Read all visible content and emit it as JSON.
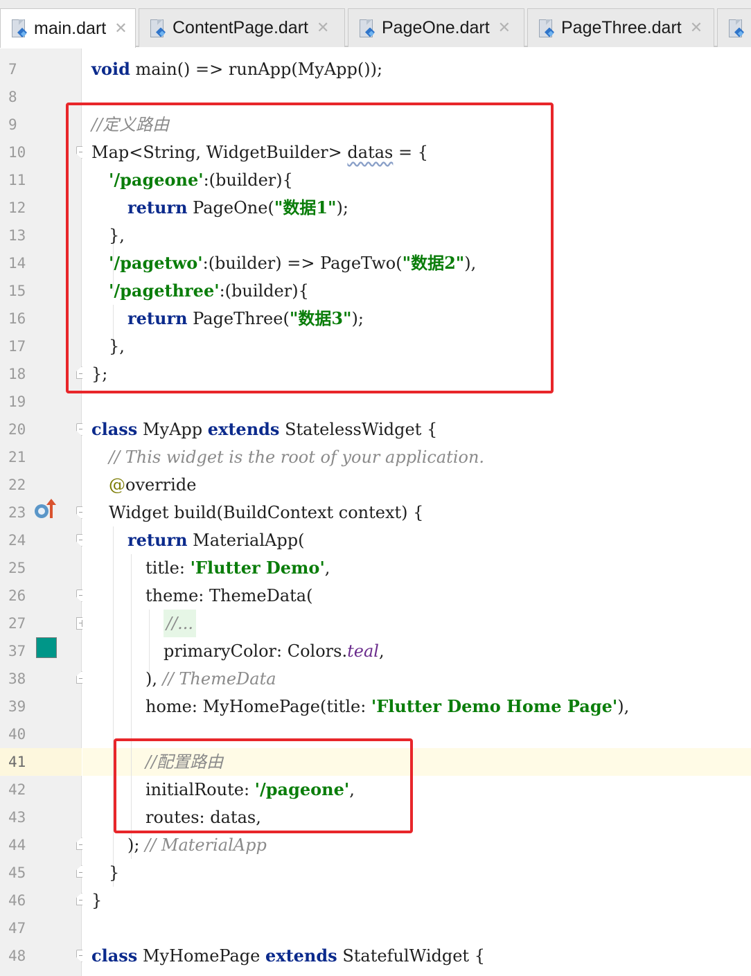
{
  "tabs": [
    {
      "label": "main.dart",
      "active": true
    },
    {
      "label": "ContentPage.dart",
      "active": false
    },
    {
      "label": "PageOne.dart",
      "active": false
    },
    {
      "label": "PageThree.dart",
      "active": false
    }
  ],
  "tab_close_glyph": "✕",
  "line_numbers": [
    "7",
    "8",
    "9",
    "10",
    "11",
    "12",
    "13",
    "14",
    "15",
    "16",
    "17",
    "18",
    "19",
    "20",
    "21",
    "22",
    "23",
    "24",
    "25",
    "26",
    "27",
    "37",
    "38",
    "39",
    "40",
    "41",
    "42",
    "43",
    "44",
    "45",
    "46",
    "47",
    "48"
  ],
  "code": {
    "l7": [
      "void",
      " main() => runApp(MyApp());"
    ],
    "l9": "//定义路由",
    "l10": [
      "Map<String, WidgetBuilder> ",
      "datas",
      " = {"
    ],
    "l11": [
      "'/pageone'",
      ":(builder){"
    ],
    "l12": [
      "return",
      " PageOne(",
      "\"数据1\"",
      ");"
    ],
    "l13": "},",
    "l14": [
      "'/pagetwo'",
      ":(builder) => PageTwo(",
      "\"数据2\"",
      "),"
    ],
    "l15": [
      "'/pagethree'",
      ":(builder){"
    ],
    "l16": [
      "return",
      " PageThree(",
      "\"数据3\"",
      ");"
    ],
    "l17": "},",
    "l18": "};",
    "l20": [
      "class",
      " MyApp ",
      "extends",
      " StatelessWidget {"
    ],
    "l21": "// This widget is the root of your application.",
    "l22": [
      "@",
      "override"
    ],
    "l23": "Widget build(BuildContext context) {",
    "l24": [
      "return",
      " MaterialApp("
    ],
    "l25": [
      "title: ",
      "'Flutter Demo'",
      ","
    ],
    "l26": "theme: ThemeData(",
    "l27": "//...",
    "l37": [
      "primaryColor: Colors.",
      "teal",
      ","
    ],
    "l38": [
      "), ",
      "// ThemeData"
    ],
    "l39": [
      "home: MyHomePage(title: ",
      "'Flutter Demo Home Page'",
      "),"
    ],
    "l41": "//配置路由",
    "l42": [
      "initialRoute: ",
      "'/pageone'",
      ","
    ],
    "l43": "routes: datas,",
    "l44": [
      "); ",
      "// MaterialApp"
    ],
    "l45": "}",
    "l46": "}",
    "l48": [
      "class",
      " MyHomePage ",
      "extends",
      " StatefulWidget {"
    ]
  },
  "colors": {
    "keyword": "#0b2a8c",
    "string": "#0a7d0a",
    "comment": "#8a8a8a",
    "highlight_box": "#e8262a",
    "teal_swatch": "#009688",
    "current_line": "#fffbe6"
  },
  "icons": {
    "file_icon": "dart-file-icon",
    "override_marker": "override-up-arrow-icon",
    "color_preview": "color-swatch-icon"
  }
}
